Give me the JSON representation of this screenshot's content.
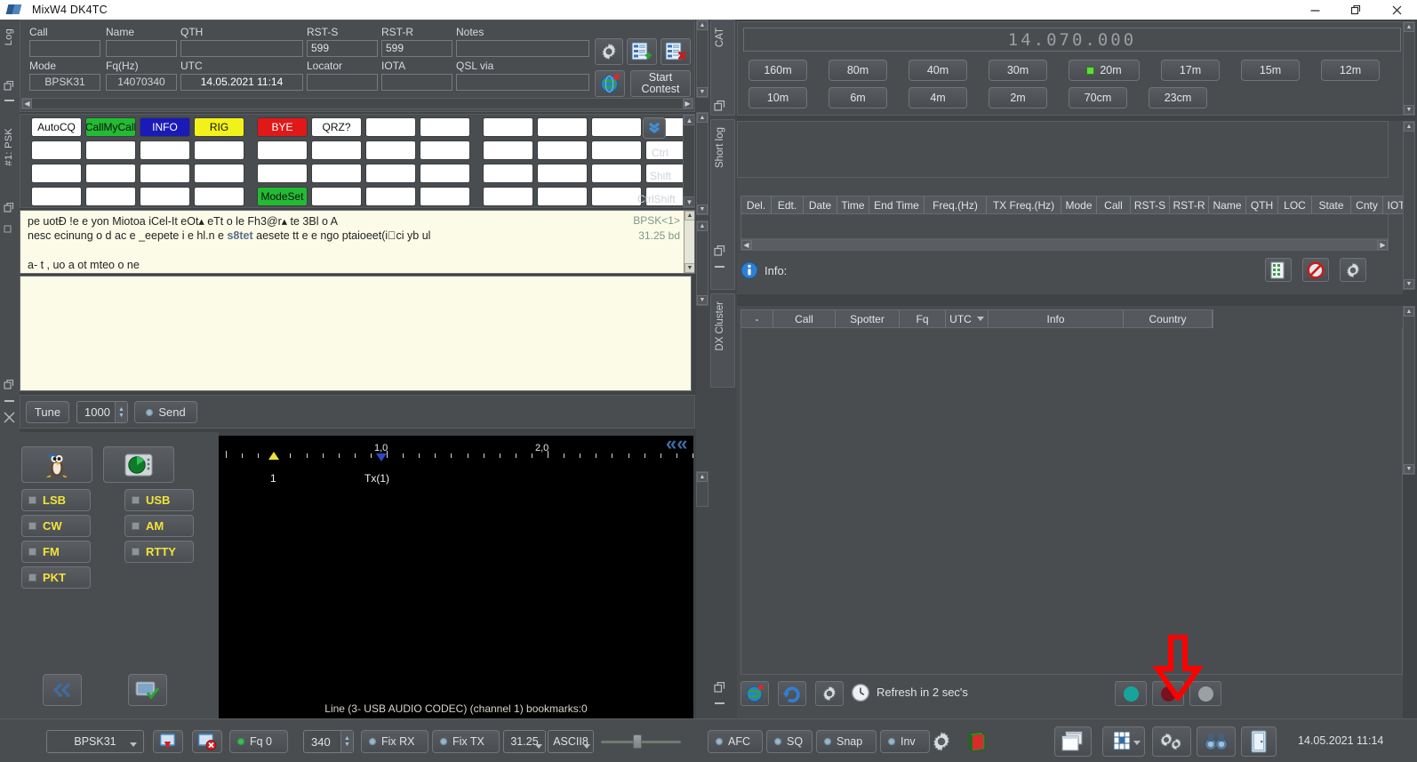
{
  "window": {
    "title": "MixW4 DK4TC",
    "minimize": "minimize-icon",
    "maximize": "restore-icon",
    "close": "close-icon"
  },
  "left_strip": {
    "tab_label": "#1: PSK",
    "top_label": "Log"
  },
  "entry": {
    "labels": {
      "call": "Call",
      "name": "Name",
      "qth": "QTH",
      "rst_s": "RST-S",
      "rst_r": "RST-R",
      "notes": "Notes",
      "mode": "Mode",
      "fq": "Fq(Hz)",
      "utc": "UTC",
      "locator": "Locator",
      "iota": "IOTA",
      "qsl_via": "QSL via"
    },
    "values": {
      "call": "",
      "name": "",
      "qth": "",
      "rst_s": "599",
      "rst_r": "599",
      "notes": "",
      "mode": "BPSK31",
      "fq": "14070340",
      "utc": "14.05.2021 11:14",
      "locator": "",
      "iota": "",
      "qsl_via": ""
    },
    "buttons": {
      "settings": "gear-icon",
      "add_qso": "add-record-icon",
      "del_qso": "delete-record-icon",
      "world": "globe-icon",
      "start_contest": "Start\nContest",
      "start_contest_l1": "Start",
      "start_contest_l2": "Contest"
    }
  },
  "macros": {
    "rows": [
      [
        "AutoCQ",
        "CallMyCall",
        "INFO",
        "RIG",
        "BYE",
        "QRZ?",
        "",
        "",
        "",
        "",
        "",
        ""
      ],
      [
        "",
        "",
        "",
        "",
        "",
        "",
        "",
        "",
        "",
        "",
        "",
        ""
      ],
      [
        "",
        "",
        "",
        "",
        "",
        "",
        "",
        "",
        "",
        "",
        "",
        ""
      ],
      [
        "",
        "",
        "",
        "",
        "ModeSet",
        "",
        "",
        "",
        "",
        "",
        "",
        ""
      ]
    ],
    "colors": {
      "AutoCQ": {
        "bg": "#ffffff",
        "fg": "#111111"
      },
      "CallMyCall": {
        "bg": "#22bb33",
        "fg": "#111111"
      },
      "INFO": {
        "bg": "#1a1ab8",
        "fg": "#ffffff"
      },
      "RIG": {
        "bg": "#f2f21a",
        "fg": "#111111"
      },
      "BYE": {
        "bg": "#e01818",
        "fg": "#ffffff"
      },
      "QRZ?": {
        "bg": "#ffffff",
        "fg": "#111111"
      },
      "ModeSet": {
        "bg": "#22bb33",
        "fg": "#111111"
      }
    },
    "modifier_labels": [
      "Ctrl",
      "Shift",
      "CtrlShift"
    ],
    "expand_icon": "chevron-double-down-icon"
  },
  "rx_pane": {
    "lines": [
      "pe uotÐ !e e yon Miotoa iCel-It eOt▴ eTt o le Fh3@r▴ te 3Bl o A",
      "nesc ecinung o d ac e _eepete i e hl.n e ",
      "s8tet",
      " aesete tt e e ngo ptaioeet(i⃨ci yb ul",
      "a- t , uo a ot mteo o ne"
    ],
    "mode_tag": "BPSK<1>",
    "baud_tag": "31.25 bd"
  },
  "tunebar": {
    "tune": "Tune",
    "freq_value": "1000",
    "send": "Send"
  },
  "mode_panel": {
    "icon_left": "penguin-icon",
    "icon_right": "radar-scope-icon",
    "buttons": [
      "LSB",
      "USB",
      "CW",
      "AM",
      "FM",
      "RTTY",
      "PKT"
    ],
    "bottom_icon_left": "chevron-double-left-icon",
    "bottom_icon_right": "monitor-check-icon"
  },
  "waterfall": {
    "ruler_labels": [
      "1,0",
      "2,0"
    ],
    "rx_marker_label": "1",
    "tx_marker_label": "Tx(1)",
    "status": "Line (3- USB AUDIO  CODEC) (channel 1) bookmarks:0",
    "chevron_icon": "chevron-double-left-icon"
  },
  "right_tabs": [
    "CAT",
    "Short log",
    "DX Cluster"
  ],
  "cat": {
    "frequency": "14.070.000",
    "bands_row1": [
      "160m",
      "80m",
      "40m",
      "30m",
      "20m",
      "17m",
      "15m",
      "12m"
    ],
    "bands_row2": [
      "10m",
      "6m",
      "4m",
      "2m",
      "70cm",
      "23cm"
    ],
    "active_band": "20m"
  },
  "short_log": {
    "columns": [
      "Del.",
      "Edt.",
      "Date",
      "Time",
      "End Time",
      "Freq.(Hz)",
      "TX Freq.(Hz)",
      "Mode",
      "Call",
      "RST-S",
      "RST-R",
      "Name",
      "QTH",
      "LOC",
      "State",
      "Cnty",
      "IOT"
    ],
    "rows": [],
    "info_label": "Info:",
    "info_value": "",
    "info_icon": "info-icon",
    "buttons": [
      "grid-icon",
      "no-entry-icon",
      "gear-icon"
    ]
  },
  "dx_cluster": {
    "columns": [
      "-",
      "Call",
      "Spotter",
      "Fq",
      "UTC",
      "Info",
      "Country"
    ],
    "sort_column": "UTC",
    "sort_icon": "chevron-down-icon",
    "rows": [],
    "toolbar_left": [
      "globe-icon",
      "refresh-icon",
      "gear-icon",
      "clock-icon"
    ],
    "refresh_text": "Refresh in 2 sec's",
    "status_dots": [
      {
        "name": "connected-dot",
        "color": "#17a59b"
      },
      {
        "name": "recording-dot",
        "color": "#7a1020"
      },
      {
        "name": "idle-dot",
        "color": "#9ba0a4"
      }
    ]
  },
  "statusbar": {
    "mode": "BPSK31",
    "tx_icon": "tx-window-icon",
    "abort_icon": "abort-window-icon",
    "fq_label": "Fq 0",
    "spin_value": "340",
    "fix_rx": "Fix RX",
    "fix_tx": "Fix TX",
    "baud": "31.25",
    "charset": "ASCII8",
    "afc": "AFC",
    "sq": "SQ",
    "snap": "Snap",
    "inv": "Inv",
    "gear_icon": "gear-icon",
    "book_icon": "logbook-icon",
    "right_icons": [
      "windows-icon",
      "grid-layout-icon",
      "gears-icon",
      "binoculars-icon",
      "exit-door-icon"
    ],
    "clock": "14.05.2021 11:14"
  },
  "annotation": {
    "arrow": "red-down-arrow",
    "color": "#ff0000"
  }
}
